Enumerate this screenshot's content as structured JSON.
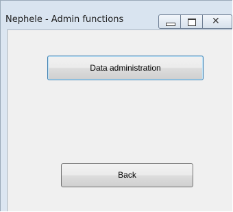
{
  "window": {
    "title": "Nephele - Admin functions",
    "controls": {
      "minimize_icon": "minimize-icon",
      "maximize_icon": "maximize-icon",
      "close_icon": "close-icon",
      "close_glyph": "✕"
    }
  },
  "buttons": {
    "data_administration": "Data administration",
    "back": "Back"
  },
  "colors": {
    "frame": "#dce6f1",
    "client_background": "#f0f0f0",
    "focused_button_border": "#3c7fb1"
  }
}
